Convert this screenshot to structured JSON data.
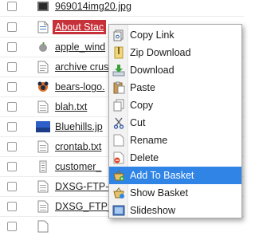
{
  "files": [
    {
      "name": "969014img20.jpg",
      "icon": "image-thumb-icon",
      "selected": false
    },
    {
      "name": "About Stac",
      "icon": "document-icon",
      "selected": true
    },
    {
      "name": "apple_wind",
      "icon": "apple-logo-icon",
      "selected": false
    },
    {
      "name": "archive crus",
      "icon": "archive-icon",
      "selected": false
    },
    {
      "name": "bears-logo.",
      "icon": "bears-logo-icon",
      "selected": false
    },
    {
      "name": "blah.txt",
      "icon": "text-file-icon",
      "selected": false
    },
    {
      "name": "Bluehills.jp",
      "icon": "landscape-thumb-icon",
      "selected": false
    },
    {
      "name": "crontab.txt",
      "icon": "text-file-icon",
      "selected": false
    },
    {
      "name": "customer_",
      "icon": "spreadsheet-icon",
      "selected": false
    },
    {
      "name": "DXSG-FTP-T",
      "icon": "text-file-icon",
      "selected": false
    },
    {
      "name": "DXSG_FTP_T",
      "icon": "text-file-icon",
      "selected": false
    },
    {
      "name": "",
      "icon": "text-file-icon",
      "selected": false
    }
  ],
  "context_menu": {
    "items": [
      {
        "label": "Copy Link",
        "icon": "copy-link-icon",
        "active": false
      },
      {
        "label": "Zip Download",
        "icon": "zip-icon",
        "active": false
      },
      {
        "label": "Download",
        "icon": "download-icon",
        "active": false
      },
      {
        "label": "Paste",
        "icon": "paste-icon",
        "active": false
      },
      {
        "label": "Copy",
        "icon": "copy-icon",
        "active": false
      },
      {
        "label": "Cut",
        "icon": "scissors-icon",
        "active": false
      },
      {
        "label": "Rename",
        "icon": "rename-icon",
        "active": false
      },
      {
        "label": "Delete",
        "icon": "delete-icon",
        "active": false
      },
      {
        "label": "Add To Basket",
        "icon": "basket-add-icon",
        "active": true
      },
      {
        "label": "Show Basket",
        "icon": "basket-icon",
        "active": false
      },
      {
        "label": "Slideshow",
        "icon": "slideshow-icon",
        "active": false
      }
    ]
  },
  "colors": {
    "selection_red": "#c7313a",
    "menu_highlight": "#2f84e6"
  }
}
